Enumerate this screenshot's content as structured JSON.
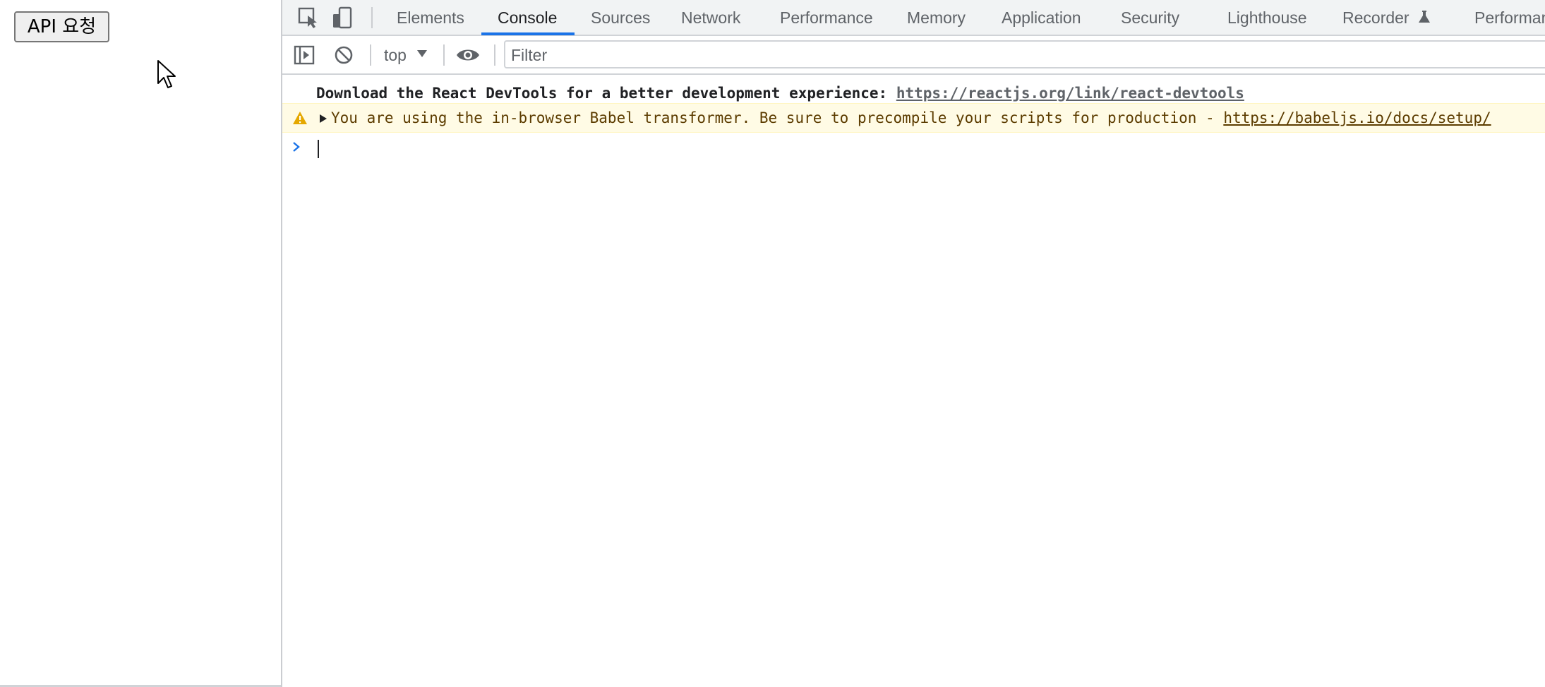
{
  "page": {
    "api_button_label": "API 요청"
  },
  "devtools": {
    "tabs": [
      {
        "label": "Elements"
      },
      {
        "label": "Console",
        "active": true
      },
      {
        "label": "Sources"
      },
      {
        "label": "Network"
      },
      {
        "label": "Performance"
      },
      {
        "label": "Memory"
      },
      {
        "label": "Application"
      },
      {
        "label": "Security"
      },
      {
        "label": "Lighthouse"
      },
      {
        "label": "Recorder"
      },
      {
        "label": "Performar"
      }
    ],
    "toolbar": {
      "context": "top",
      "filter_placeholder": "Filter"
    },
    "console": {
      "messages": [
        {
          "level": "info",
          "text": "Download the React DevTools for a better development experience: ",
          "link": "https://reactjs.org/link/react-devtools"
        },
        {
          "level": "warning",
          "text": "You are using the in-browser Babel transformer. Be sure to precompile your scripts for production - ",
          "link": "https://babeljs.io/docs/setup/"
        }
      ]
    }
  },
  "colors": {
    "accent": "#1a73e8",
    "warning_bg": "#fffbe5",
    "warning_text": "#5c3c00",
    "warning_icon": "#e5a800"
  },
  "icons": [
    "inspect-element-icon",
    "device-toolbar-icon",
    "show-sidebar-icon",
    "clear-console-icon",
    "eye-icon",
    "warning-icon",
    "expand-triangle-icon",
    "prompt-chevron-icon",
    "flask-icon",
    "mouse-cursor-icon"
  ]
}
